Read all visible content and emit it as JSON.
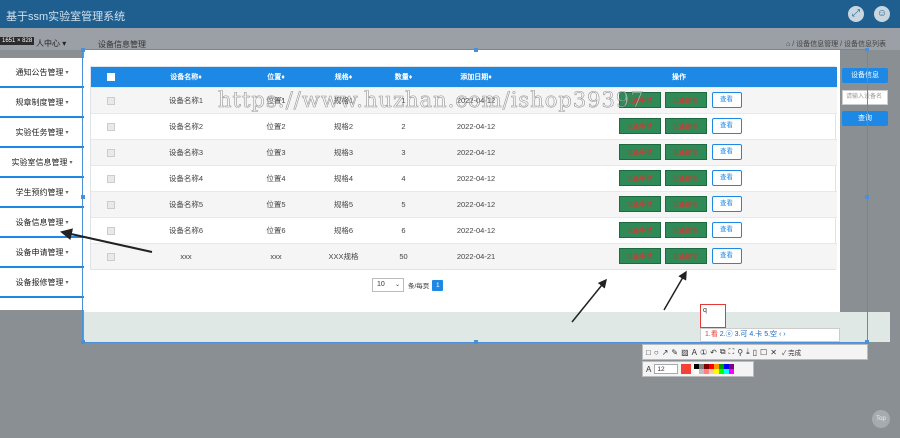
{
  "app": {
    "title": "基于ssm实验室管理系统"
  },
  "size_badge": "1651 × 828",
  "user_center": {
    "label": "人中心",
    "caret": "▾"
  },
  "header": {
    "page_title": "设备信息管理",
    "breadcrumb": "⌂ / 设备信息管理 / 设备信息列表"
  },
  "sidebar": {
    "items": [
      {
        "label": "通知公告管理"
      },
      {
        "label": "规章制度管理"
      },
      {
        "label": "实验任务管理"
      },
      {
        "label": "实验室信息管理"
      },
      {
        "label": "学生预约管理"
      },
      {
        "label": "设备信息管理"
      },
      {
        "label": "设备申请管理"
      },
      {
        "label": "设备报修管理"
      }
    ],
    "caret": "▾"
  },
  "table": {
    "headers": [
      "设备名称♦",
      "位置♦",
      "规格♦",
      "数量♦",
      "添加日期♦",
      "操作"
    ],
    "rows": [
      {
        "name": "设备名称1",
        "location": "位置1",
        "spec": "规格1",
        "qty": "1",
        "date": "2022-04-12"
      },
      {
        "name": "设备名称2",
        "location": "位置2",
        "spec": "规格2",
        "qty": "2",
        "date": "2022-04-12"
      },
      {
        "name": "设备名称3",
        "location": "位置3",
        "spec": "规格3",
        "qty": "3",
        "date": "2022-04-12"
      },
      {
        "name": "设备名称4",
        "location": "位置4",
        "spec": "规格4",
        "qty": "4",
        "date": "2022-04-12"
      },
      {
        "name": "设备名称5",
        "location": "位置5",
        "spec": "规格5",
        "qty": "5",
        "date": "2022-04-12"
      },
      {
        "name": "设备名称6",
        "location": "位置6",
        "spec": "规格6",
        "qty": "6",
        "date": "2022-04-12"
      },
      {
        "name": "xxx",
        "location": "xxx",
        "spec": "XXX规格",
        "qty": "50",
        "date": "2022-04-21"
      }
    ],
    "actions": {
      "apply": "设备申请",
      "repair": "设备报修",
      "view": "查看"
    }
  },
  "pager": {
    "page_size": "10",
    "per_page_label": "条/每页",
    "current_page": "1"
  },
  "right_panel": {
    "title_button": "设备信息",
    "search_placeholder": "请输入设备名",
    "search_button": "查询"
  },
  "watermark": "https://www.huzhan.com/ishop39397",
  "ime": {
    "typed": "q",
    "candidates": [
      {
        "label": "1.看",
        "first": true
      },
      {
        "label": "2.ⓞ"
      },
      {
        "label": "3.可"
      },
      {
        "label": "4.卡"
      },
      {
        "label": "5.空"
      },
      {
        "label": "‹ ›"
      }
    ]
  },
  "screenshot_toolbar": {
    "tools": [
      "□",
      "○",
      "↗",
      "✎",
      "▨",
      "A",
      "①",
      "↶",
      "⧉",
      "⛶",
      "⚲",
      "⤓",
      "▯",
      "☐",
      "✕"
    ],
    "done_label": "✓ 完成",
    "font_size": "12",
    "current_color": "#f44336",
    "swatches": [
      "#000000",
      "#808080",
      "#7f0000",
      "#ff0000",
      "#ff9900",
      "#00a000",
      "#0000ff",
      "#800080",
      "#ffffff",
      "#c0c0c0",
      "#ff8080",
      "#ffcc99",
      "#ffff00",
      "#00ff00",
      "#00ffff",
      "#ff00ff"
    ]
  },
  "corner_button": "Top",
  "top_buttons": {
    "fullscreen": "⤢",
    "user": "☺"
  }
}
